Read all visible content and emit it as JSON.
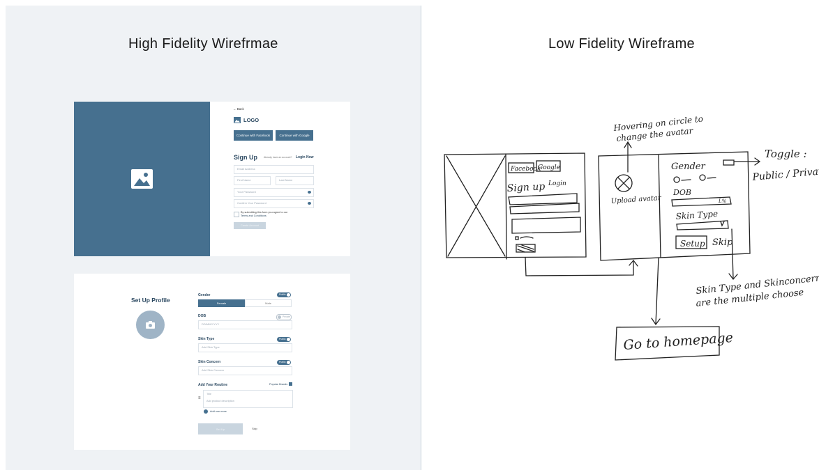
{
  "left_title": "High Fidelity Wirefrmae",
  "right_title": "Low Fidelity Wireframe",
  "signup": {
    "back": "← Back",
    "logo": "LOGO",
    "facebook_btn": "Continue with Facebook",
    "google_btn": "Continue with Google",
    "heading": "Sign Up",
    "already": "Already have an account?",
    "login_now": "Login Now",
    "email_placeholder": "Email Address",
    "first_name": "First Name",
    "last_name": "Last Name",
    "password": "Your Password",
    "confirm_password": "Confirm Your Password",
    "terms_text": "By submitting this form you agree to our",
    "terms_link": "Terms and Conditions",
    "submit": "Create Account"
  },
  "profile": {
    "heading": "Set Up Profile",
    "gender_label": "Gender",
    "gender_toggle": "Public",
    "female": "Female",
    "male": "Male",
    "dob_label": "DOB",
    "dob_toggle": "Private",
    "dob_placeholder": "DD/MM/YYYY",
    "skin_type_label": "Skin Type",
    "skin_type_toggle": "Public",
    "skin_type_placeholder": "Add Skin Type",
    "skin_concern_label": "Skin Concern",
    "skin_concern_toggle": "Public",
    "skin_concern_placeholder": "Add Skin Concern",
    "routine_label": "Add Your Routine",
    "routine_link": "Popular Brands",
    "routine_title": "Title",
    "routine_desc": "Add product description",
    "add_more": "Add one more",
    "setup_btn": "Set Up",
    "skip": "Skip"
  },
  "sketch": {
    "annotation_avatar_1": "Hovering on circle to",
    "annotation_avatar_2": "change the avatar",
    "facebook": "Facebook",
    "google": "Google",
    "sign_up": "Sign up",
    "login": "Login",
    "upload_avatar": "Upload avatar",
    "gender": "Gender",
    "dob": "DOB",
    "skin_type": "Skin Type",
    "setup": "Setup",
    "skip": "Skip",
    "toggle_1": "Toggle :",
    "toggle_2": "Public / Private",
    "skin_note_1": "Skin Type and Skinconcern",
    "skin_note_2": "are the multiple choose",
    "homepage": "Go to homepage",
    "dob_value": "L%"
  }
}
